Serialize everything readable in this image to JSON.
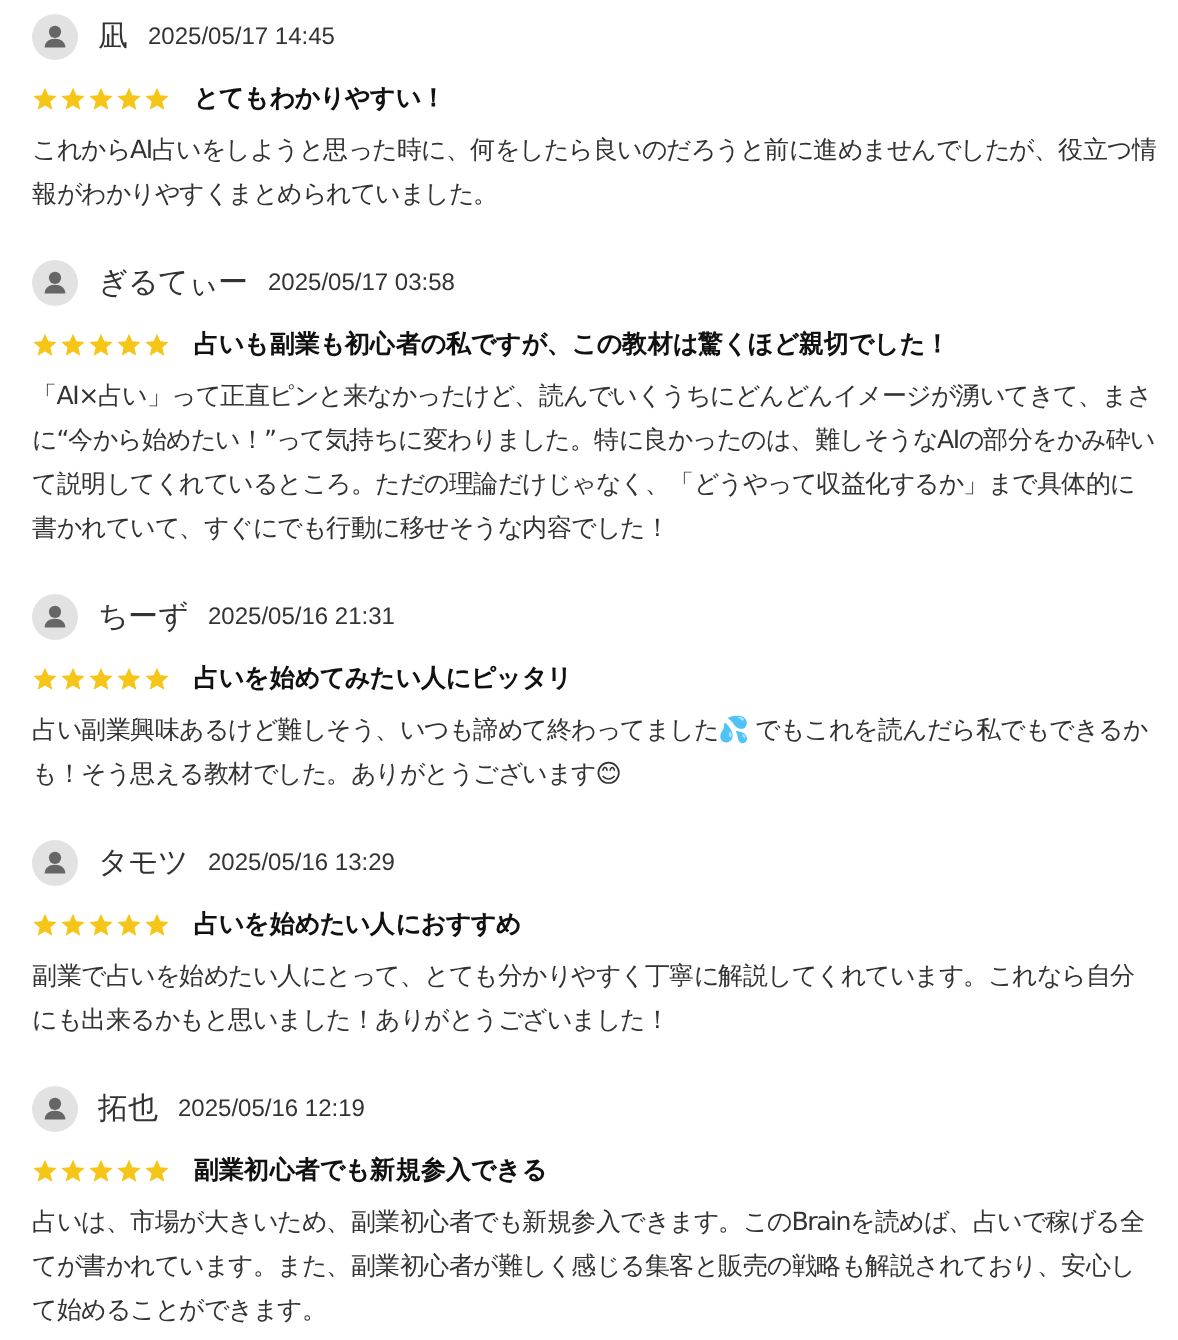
{
  "reviews": [
    {
      "name": "凪",
      "date": "2025/05/17 14:45",
      "stars": 5,
      "title": "とてもわかりやすい！",
      "body": "これからAI占いをしようと思った時に、何をしたら良いのだろうと前に進めませんでしたが、役立つ情報がわかりやすくまとめられていました。"
    },
    {
      "name": "ぎるてぃー",
      "date": "2025/05/17 03:58",
      "stars": 5,
      "title": "占いも副業も初心者の私ですが、この教材は驚くほど親切でした！",
      "body": "「AI×占い」って正直ピンと来なかったけど、読んでいくうちにどんどんイメージが湧いてきて、まさに“今から始めたい！”って気持ちに変わりました。特に良かったのは、難しそうなAIの部分をかみ砕いて説明してくれているところ。ただの理論だけじゃなく、「どうやって収益化するか」まで具体的に書かれていて、すぐにでも行動に移せそうな内容でした！"
    },
    {
      "name": "ちーず",
      "date": "2025/05/16 21:31",
      "stars": 5,
      "title": "占いを始めてみたい人にピッタリ",
      "body": "占い副業興味あるけど難しそう、いつも諦めて終わってました💦 でもこれを読んだら私でもできるかも！そう思える教材でした。ありがとうございます😊"
    },
    {
      "name": "タモツ",
      "date": "2025/05/16 13:29",
      "stars": 5,
      "title": "占いを始めたい人におすすめ",
      "body": "副業で占いを始めたい人にとって、とても分かりやすく丁寧に解説してくれています。これなら自分にも出来るかもと思いました！ありがとうございました！"
    },
    {
      "name": "拓也",
      "date": "2025/05/16 12:19",
      "stars": 5,
      "title": "副業初心者でも新規参入できる",
      "body": "占いは、市場が大きいため、副業初心者でも新規参入できます。このBrainを読めば、占いで稼げる全てが書かれています。また、副業初心者が難しく感じる集客と販売の戦略も解説されており、安心して始めることができます。"
    }
  ]
}
